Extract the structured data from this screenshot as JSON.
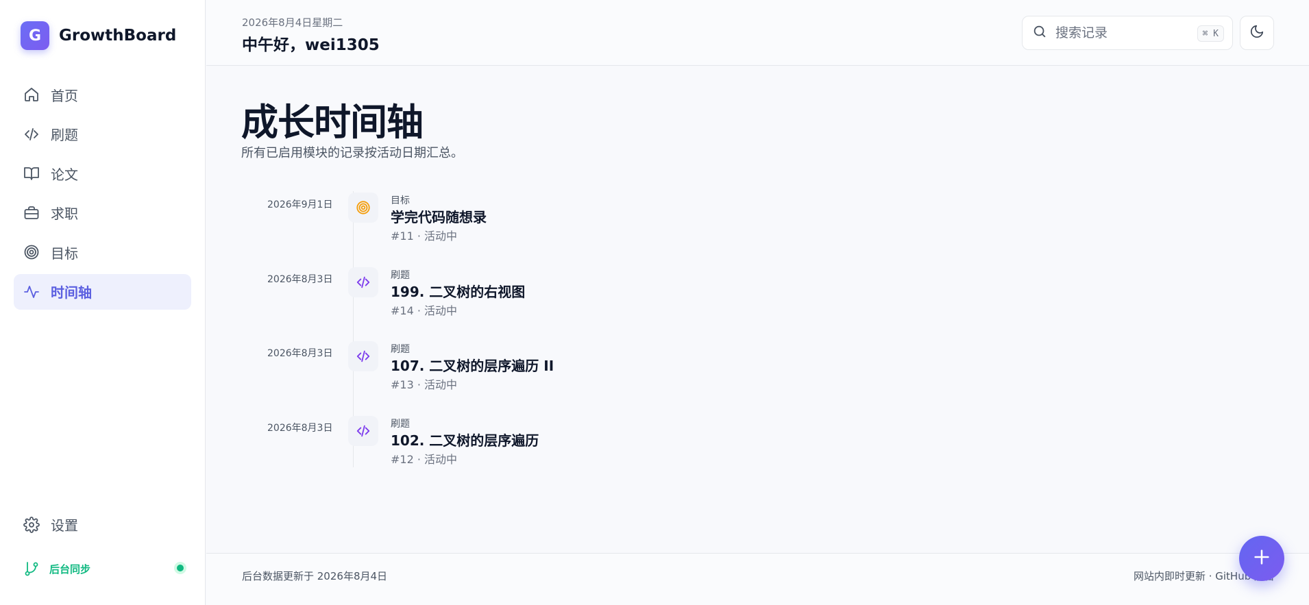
{
  "brand": {
    "logo_letter": "G",
    "name": "GrowthBoard"
  },
  "sidebar": {
    "items": [
      {
        "label": "首页",
        "icon": "home-icon"
      },
      {
        "label": "刷题",
        "icon": "code-icon"
      },
      {
        "label": "论文",
        "icon": "book-icon"
      },
      {
        "label": "求职",
        "icon": "briefcase-icon"
      },
      {
        "label": "目标",
        "icon": "target-icon"
      },
      {
        "label": "时间轴",
        "icon": "activity-icon",
        "active": true
      }
    ],
    "settings_label": "设置",
    "sync_label": "后台同步"
  },
  "header": {
    "date": "2026年8月4日星期二",
    "greeting": "中午好，wei1305",
    "search_placeholder": "搜索记录",
    "search_shortcut": "⌘ K"
  },
  "page": {
    "title": "成长时间轴",
    "subtitle": "所有已启用模块的记录按活动日期汇总。"
  },
  "timeline": [
    {
      "date": "2026年9月1日",
      "category": "目标",
      "title": "学完代码随想录",
      "meta": "#11 · 活动中",
      "icon": "target-icon"
    },
    {
      "date": "2026年8月3日",
      "category": "刷题",
      "title": "199. 二叉树的右视图",
      "meta": "#14 · 活动中",
      "icon": "code-icon"
    },
    {
      "date": "2026年8月3日",
      "category": "刷题",
      "title": "107. 二叉树的层序遍历 II",
      "meta": "#13 · 活动中",
      "icon": "code-icon"
    },
    {
      "date": "2026年8月3日",
      "category": "刷题",
      "title": "102. 二叉树的层序遍历",
      "meta": "#12 · 活动中",
      "icon": "code-icon"
    }
  ],
  "footer": {
    "left": "后台数据更新于 2026年8月4日",
    "right": "网站内即时更新 · GitHub 后台"
  },
  "colors": {
    "accent": "#6366f1",
    "goal": "#f59e0b",
    "code": "#7c3aed",
    "sync": "#10b981"
  }
}
